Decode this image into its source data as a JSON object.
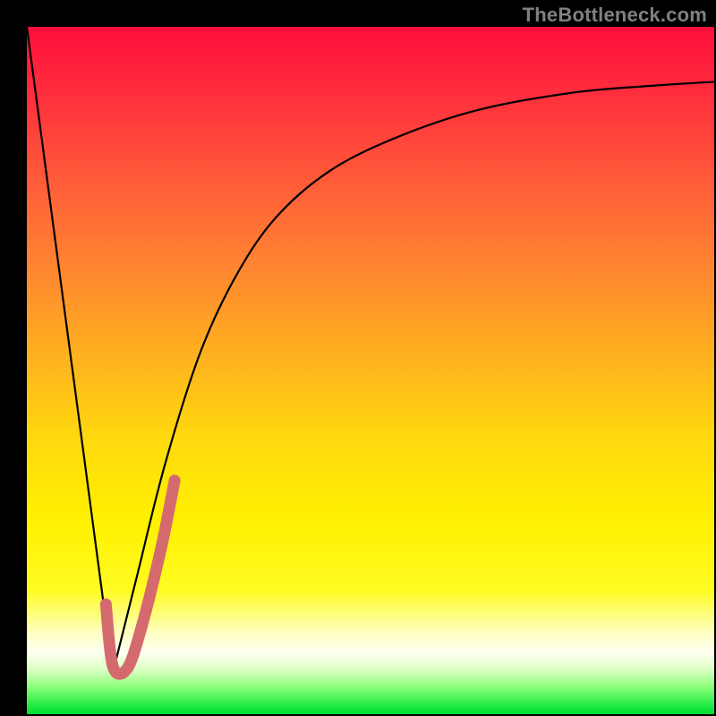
{
  "watermark": "TheBottleneck.com",
  "chart_data": {
    "type": "line",
    "title": "",
    "xlabel": "",
    "ylabel": "",
    "xlim": [
      0,
      1
    ],
    "ylim": [
      0,
      1
    ],
    "series": [
      {
        "name": "left-descent",
        "x": [
          0.0,
          0.125
        ],
        "values": [
          1.0,
          0.06
        ]
      },
      {
        "name": "right-rise",
        "x": [
          0.125,
          0.16,
          0.2,
          0.25,
          0.3,
          0.36,
          0.44,
          0.54,
          0.66,
          0.8,
          0.92,
          1.0
        ],
        "values": [
          0.06,
          0.2,
          0.36,
          0.52,
          0.63,
          0.72,
          0.79,
          0.84,
          0.88,
          0.905,
          0.915,
          0.92
        ]
      },
      {
        "name": "pink-hook",
        "x": [
          0.115,
          0.125,
          0.145,
          0.165,
          0.195,
          0.215
        ],
        "values": [
          0.16,
          0.07,
          0.065,
          0.12,
          0.24,
          0.34
        ]
      }
    ],
    "colors": {
      "curve": "#000000",
      "hook": "#d46a6e"
    }
  }
}
